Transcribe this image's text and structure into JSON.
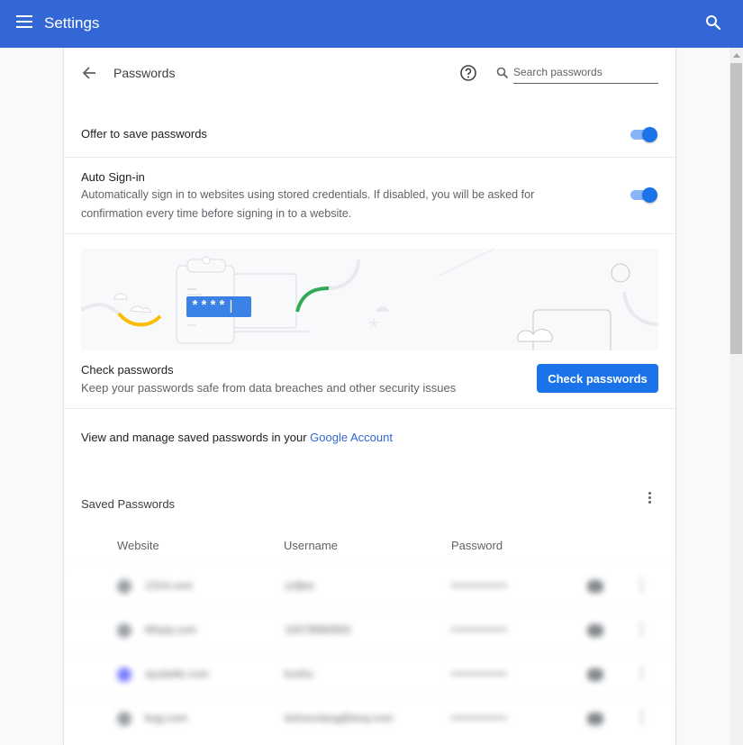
{
  "topbar": {
    "title": "Settings",
    "menu_icon": "hamburger-menu-icon",
    "search_icon": "search-icon",
    "color": "#3367d6"
  },
  "subpage": {
    "back_icon": "arrow-back-icon",
    "title": "Passwords",
    "help_icon": "help-circle-icon",
    "search": {
      "placeholder": "Search passwords",
      "value": ""
    }
  },
  "settings": {
    "offer_to_save": {
      "label": "Offer to save passwords",
      "enabled": true
    },
    "auto_sign_in": {
      "label": "Auto Sign-in",
      "description": "Automatically sign in to websites using stored credentials. If disabled, you will be asked for confirmation every time before signing in to a website.",
      "enabled": true
    }
  },
  "check": {
    "banner_text": "****",
    "title": "Check passwords",
    "description": "Keep your passwords safe from data breaches and other security issues",
    "button_label": "Check passwords",
    "accent": "#1a73e8"
  },
  "account": {
    "prefix": "View and manage saved passwords in your ",
    "link": "Google Account"
  },
  "saved": {
    "title": "Saved Passwords",
    "columns": [
      "Website",
      "Username",
      "Password"
    ],
    "rows": [
      {
        "site": "1314.com",
        "user": "zzfjkw",
        "password": "••••••••••••",
        "favicon_color": "#9aa0a6"
      },
      {
        "site": "6thpiy.com",
        "user": "15578680893",
        "password": "••••••••••••",
        "favicon_color": "#9aa0a6"
      },
      {
        "site": "ayubelle.com",
        "user": "koshu",
        "password": "••••••••••••",
        "favicon_color": "#7b7bff"
      },
      {
        "site": "bujy.com",
        "user": "bshunclang@tesy.com",
        "password": "••••••••••••",
        "favicon_color": "#9aa0a6"
      }
    ]
  },
  "scrollbar": {
    "position_fraction": 0.0,
    "visible_fraction": 0.42
  }
}
